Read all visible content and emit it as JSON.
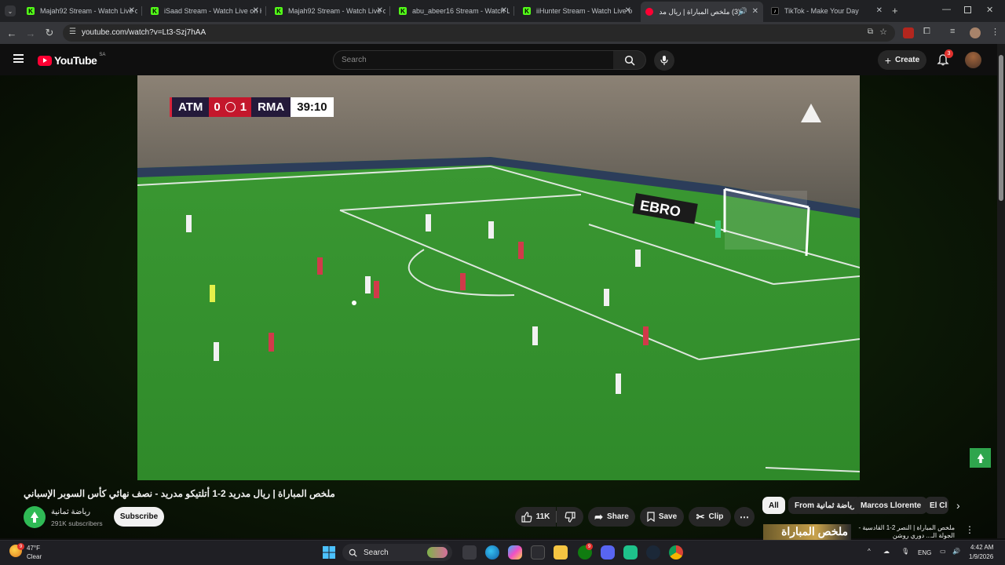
{
  "browser": {
    "tabs": [
      {
        "title": "Majah92 Stream - Watch Live o",
        "favicon": "kick-icon",
        "active": false
      },
      {
        "title": "iSaad Stream - Watch Live on K",
        "favicon": "kick-icon",
        "active": false
      },
      {
        "title": "Majah92 Stream - Watch Live o",
        "favicon": "kick-icon",
        "active": false
      },
      {
        "title": "abu_abeer16 Stream - Watch Li",
        "favicon": "kick-icon",
        "active": false
      },
      {
        "title": "iiHunter Stream - Watch Live o",
        "favicon": "kick-icon",
        "active": false
      },
      {
        "title": "(3) ملخص المباراة | ريال مدري",
        "favicon": "youtube-icon",
        "active": true
      },
      {
        "title": "TikTok - Make Your Day",
        "favicon": "tiktok-icon",
        "active": false
      }
    ],
    "url": "youtube.com/watch?v=Lt3-Szj7hAA"
  },
  "youtube": {
    "logo_text": "YouTube",
    "region": "SA",
    "search_placeholder": "Search",
    "create_label": "Create",
    "notification_count": "3"
  },
  "video": {
    "scorebug": {
      "home": "ATM",
      "home_score": "0",
      "away_score": "1",
      "away": "RMA",
      "clock": "39:10"
    },
    "board_text": "EBRO"
  },
  "details": {
    "title": "ملخص المباراة | ريال مدريد 2-1 أتلتيكو مدريد - نصف نهائي كأس السوبر الإسباني",
    "channel": "رياضة ثمانية",
    "subscribers": "291K subscribers",
    "subscribe_label": "Subscribe",
    "likes": "11K",
    "share_label": "Share",
    "save_label": "Save",
    "clip_label": "Clip"
  },
  "sidebar": {
    "chips": [
      "All",
      "From رياضة ثمانية",
      "Marcos Llorente",
      "El Cl"
    ],
    "rec_thumb_text": "ملخص المباراة",
    "rec_title": "ملخص المباراة | النصر 2-1 القادسية - الجولة الـ... دوري روشن"
  },
  "taskbar": {
    "weather_temp": "47°F",
    "weather_desc": "Clear",
    "search_label": "Search",
    "language": "ENG",
    "time": "4:42 AM",
    "date": "1/9/2026"
  },
  "colors": {
    "youtube_red": "#ff0033",
    "kick_green": "#53fc18",
    "pitch_green": "#2f8a2a",
    "score_red": "#c4172c"
  }
}
